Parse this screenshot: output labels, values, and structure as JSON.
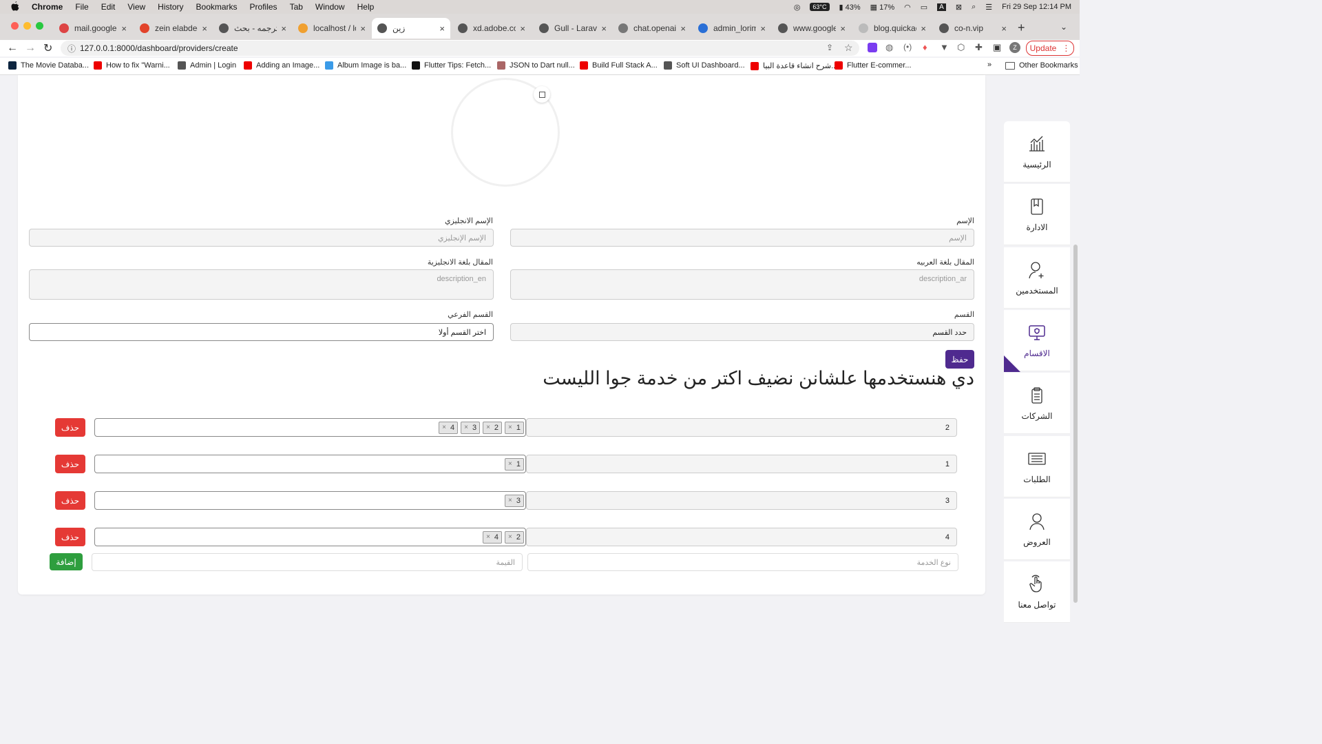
{
  "menubar": {
    "app": "Chrome",
    "items": [
      "File",
      "Edit",
      "View",
      "History",
      "Bookmarks",
      "Profiles",
      "Tab",
      "Window",
      "Help"
    ],
    "cpu_temp": "63°C",
    "battery": "43%",
    "cpu_pct": "17%",
    "clock": "Fri 29 Sep  12:14 PM"
  },
  "tabs": [
    {
      "title": "mail.google.c",
      "color": "#d44"
    },
    {
      "title": "zein elabdeen",
      "color": "#e2432a"
    },
    {
      "title": "ترجمه - بحث",
      "color": "#555"
    },
    {
      "title": "localhost / loc",
      "color": "#f0a030"
    },
    {
      "title": "زين",
      "color": "#555"
    },
    {
      "title": "xd.adobe.com",
      "color": "#555"
    },
    {
      "title": "Gull - Laravel",
      "color": "#555"
    },
    {
      "title": "chat.openai.c",
      "color": "#777"
    },
    {
      "title": "admin_lorim",
      "color": "#2a6fd6"
    },
    {
      "title": "www.google.c",
      "color": "#555"
    },
    {
      "title": "blog.quickadc",
      "color": "#bbb"
    },
    {
      "title": "co-n.vip",
      "color": "#555"
    }
  ],
  "address": {
    "url": "127.0.0.1:8000/dashboard/providers/create",
    "update_label": "Update"
  },
  "bookmarks": [
    {
      "label": "The Movie Databa...",
      "color": "#0d253f"
    },
    {
      "label": "How to fix \"Warni...",
      "color": "#e00"
    },
    {
      "label": "Admin | Login",
      "color": "#555"
    },
    {
      "label": "Adding an Image...",
      "color": "#e00"
    },
    {
      "label": "Album Image is ba...",
      "color": "#3b9be8"
    },
    {
      "label": "Flutter Tips: Fetch...",
      "color": "#111"
    },
    {
      "label": "JSON to Dart null...",
      "color": "#a66"
    },
    {
      "label": "Build Full Stack A...",
      "color": "#e00"
    },
    {
      "label": "Soft UI Dashboard...",
      "color": "#555"
    },
    {
      "label": "شرح انشاء قاعدة البيا...",
      "color": "#e00"
    },
    {
      "label": "Flutter E-commer...",
      "color": "#e00"
    }
  ],
  "bookmarks_other": "Other Bookmarks",
  "form": {
    "name_label": "الإسم",
    "name_placeholder": "الإسم",
    "name_en_label": "الإسم الانجليزي",
    "name_en_placeholder": "الإسم الإنجليزي",
    "desc_ar_label": "المقال بلغة العربيه",
    "desc_ar_placeholder": "description_ar",
    "desc_en_label": "المقال بلغة الانجليزية",
    "desc_en_placeholder": "description_en",
    "category_label": "القسم",
    "category_value": "حدد القسم",
    "subcategory_label": "القسم الفرعي",
    "subcategory_value": "اختر القسم أولا",
    "save_label": "حفظ",
    "heading": "دي هنستخدمها علشانن نضيف اكتر من خدمة جوا الليست"
  },
  "services": [
    {
      "type": "2",
      "chips": [
        "1",
        "2",
        "3",
        "4"
      ]
    },
    {
      "type": "1",
      "chips": [
        "1"
      ]
    },
    {
      "type": "3",
      "chips": [
        "3"
      ]
    },
    {
      "type": "4",
      "chips": [
        "2",
        "4"
      ]
    }
  ],
  "delete_label": "حذف",
  "new_row": {
    "type_placeholder": "نوع الخدمة",
    "value_placeholder": "القيمة",
    "add_label": "إضافة"
  },
  "sidebar": [
    {
      "label": "الرئيسية",
      "icon": "chart-icon"
    },
    {
      "label": "الادارة",
      "icon": "book-icon"
    },
    {
      "label": "المستخدمين",
      "icon": "add-user-icon"
    },
    {
      "label": "الاقسام",
      "icon": "monitor-icon"
    },
    {
      "label": "الشركات",
      "icon": "clipboard-icon"
    },
    {
      "label": "الطلبات",
      "icon": "news-icon"
    },
    {
      "label": "العروض",
      "icon": "user-icon"
    },
    {
      "label": "تواصل معنا",
      "icon": "hand-icon"
    }
  ],
  "colors": {
    "accent": "#4f2a8f",
    "danger": "#e53935",
    "success": "#2e9e3e"
  }
}
